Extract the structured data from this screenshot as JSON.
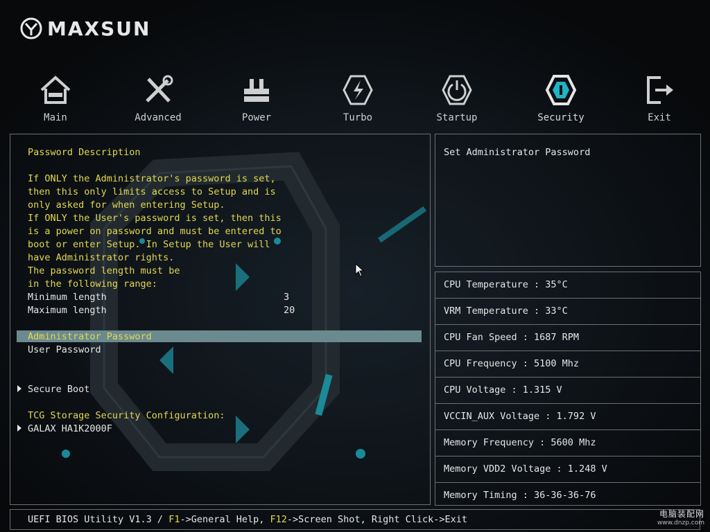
{
  "brand": {
    "name": "MAXSUN"
  },
  "nav": [
    {
      "label": "Main",
      "icon": "home-icon"
    },
    {
      "label": "Advanced",
      "icon": "tools-icon"
    },
    {
      "label": "Power",
      "icon": "power-board-icon"
    },
    {
      "label": "Turbo",
      "icon": "lightning-icon"
    },
    {
      "label": "Startup",
      "icon": "power-button-icon"
    },
    {
      "label": "Security",
      "icon": "security-icon",
      "active": true
    },
    {
      "label": "Exit",
      "icon": "exit-icon"
    }
  ],
  "left": {
    "desc_title": "Password Description",
    "desc_lines": [
      "If ONLY the Administrator's password is set,",
      "then this only limits access to Setup and is",
      "only asked for when entering Setup.",
      "If ONLY the User's password is set, then this",
      "is a power on password and must be entered to",
      "boot or enter Setup. In Setup the User will",
      "have Administrator rights.",
      "The password length must be",
      "in the following range:"
    ],
    "min_label": "Minimum length",
    "min_value": "3",
    "max_label": "Maximum length",
    "max_value": "20",
    "admin_password": "Administrator Password",
    "user_password": "User Password",
    "secure_boot": "Secure Boot",
    "tcg_title": "TCG Storage Security Configuration:",
    "tcg_device": "GALAX HA1K2000F"
  },
  "help": {
    "text": "Set Administrator Password"
  },
  "stats": [
    "CPU Temperature : 35°C",
    "VRM Temperature : 33°C",
    "CPU Fan Speed : 1687 RPM",
    "CPU Frequency : 5100 Mhz",
    "CPU Voltage : 1.315 V",
    "VCCIN_AUX Voltage : 1.792 V",
    "Memory Frequency : 5600 Mhz",
    "Memory VDD2 Voltage : 1.248 V",
    "Memory Timing : 36-36-36-76"
  ],
  "footer": {
    "prefix": "UEFI BIOS Utility V1.3 / ",
    "f1_key": "F1",
    "f1_text": "->General Help, ",
    "f12_key": "F12",
    "f12_text": "->Screen Shot, Right Click->Exit"
  },
  "watermark": {
    "line1": "电脑装配网",
    "line2": "www.dnzp.com"
  },
  "colors": {
    "highlight": "#6b8a8f",
    "text_yellow": "#e3d84f",
    "accent_teal": "#1fb3c5"
  }
}
